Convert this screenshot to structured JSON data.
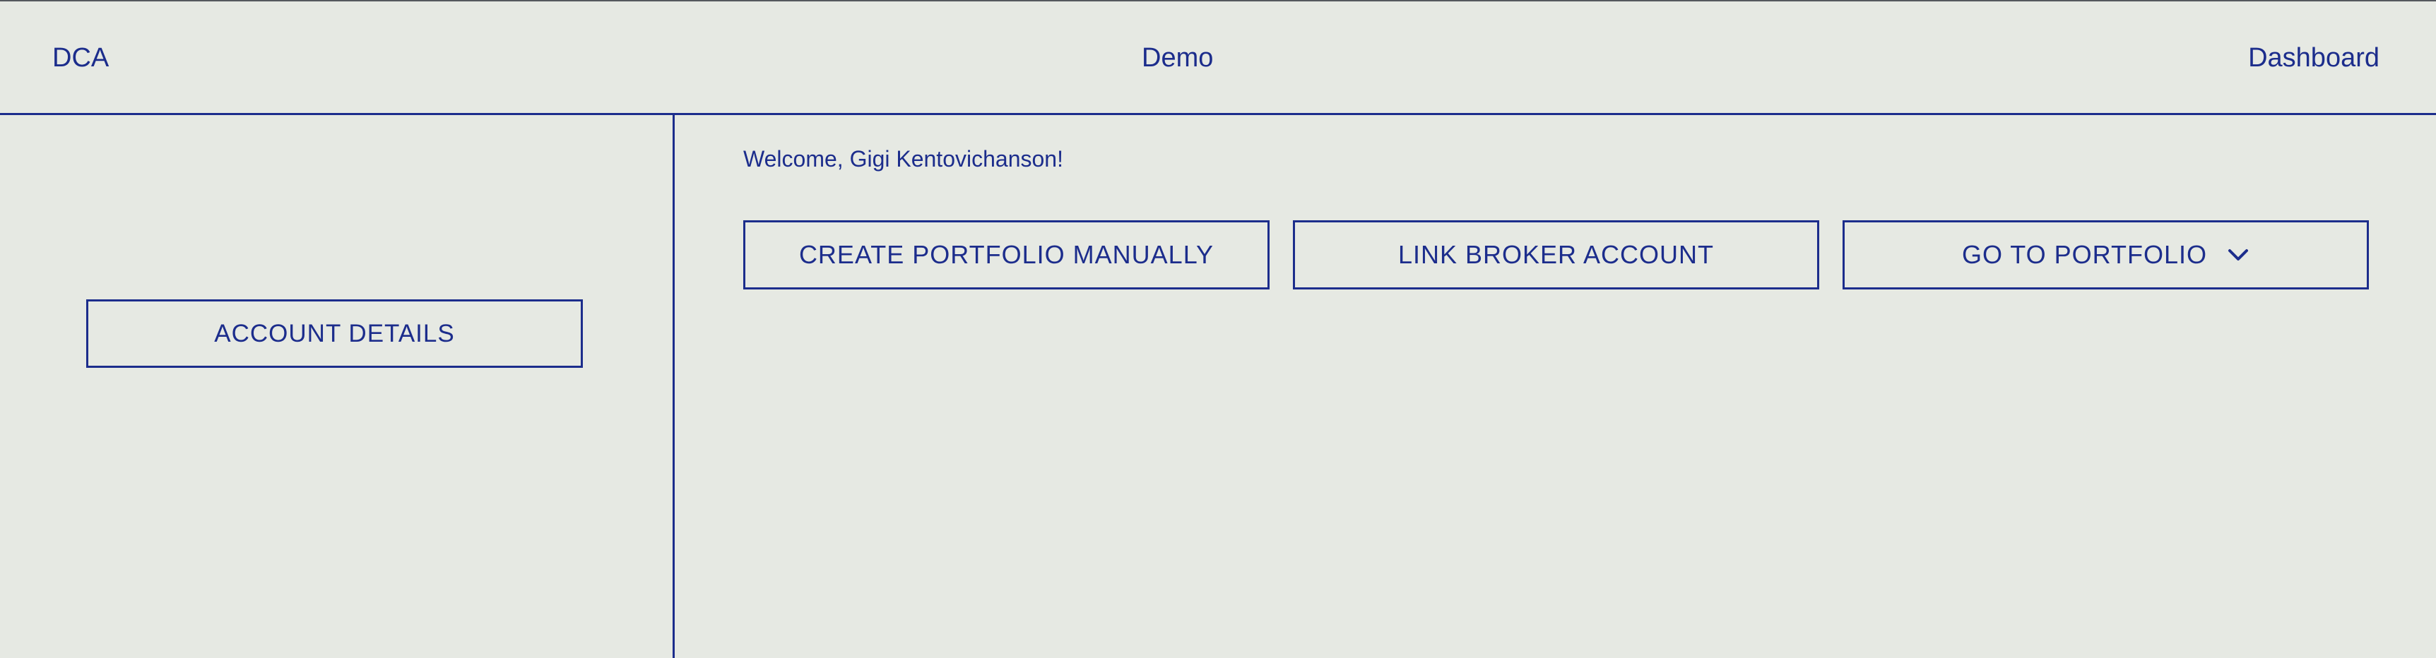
{
  "header": {
    "brand": "DCA",
    "center_label": "Demo",
    "nav_dashboard": "Dashboard"
  },
  "sidebar": {
    "account_details_label": "ACCOUNT DETAILS"
  },
  "main": {
    "welcome_text": "Welcome, Gigi Kentovichanson!",
    "actions": [
      {
        "label": "CREATE PORTFOLIO MANUALLY"
      },
      {
        "label": "LINK BROKER ACCOUNT"
      },
      {
        "label": "GO TO PORTFOLIO",
        "icon": "chevron-down-icon"
      }
    ]
  },
  "colors": {
    "background": "#e6e9e3",
    "accent": "#1c2d8c"
  }
}
